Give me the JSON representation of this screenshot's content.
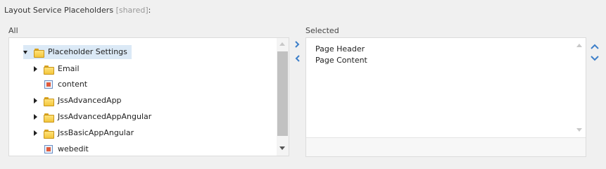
{
  "field": {
    "title": "Layout Service Placeholders",
    "shared_tag": "[shared]",
    "colon": ":"
  },
  "left": {
    "label": "All",
    "tree": [
      {
        "label": "Placeholder Settings",
        "type": "folder",
        "state": "expanded",
        "selected": true
      },
      {
        "label": "Email",
        "type": "folder",
        "state": "collapsed"
      },
      {
        "label": "content",
        "type": "placeholder"
      },
      {
        "label": "JssAdvancedApp",
        "type": "folder",
        "state": "collapsed"
      },
      {
        "label": "JssAdvancedAppAngular",
        "type": "folder",
        "state": "collapsed"
      },
      {
        "label": "JssBasicAppAngular",
        "type": "folder",
        "state": "collapsed"
      },
      {
        "label": "webedit",
        "type": "placeholder"
      }
    ]
  },
  "right": {
    "label": "Selected",
    "items": [
      "Page Header",
      "Page Content"
    ]
  },
  "colors": {
    "accent": "#3d7fc9",
    "selection": "#dbe9f6",
    "background": "#f0f0f0"
  }
}
